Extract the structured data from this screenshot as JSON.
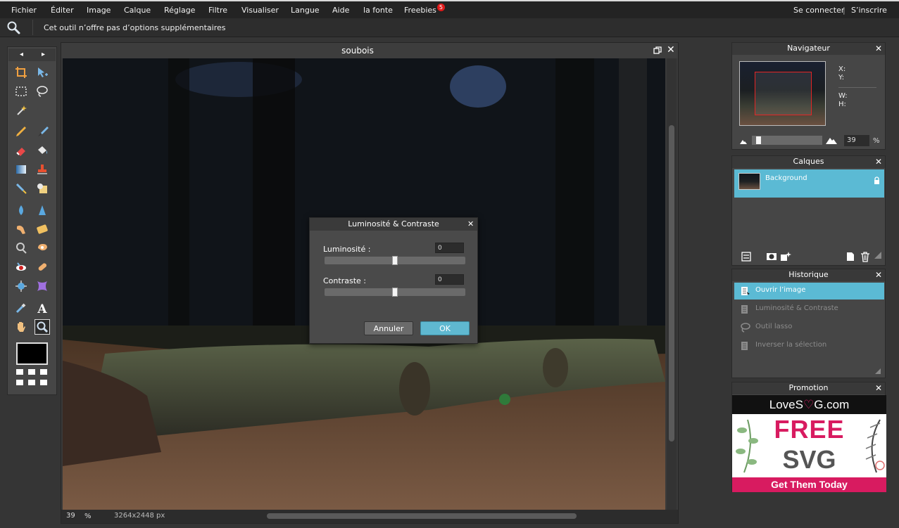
{
  "menu": {
    "items": [
      "Fichier",
      "Éditer",
      "Image",
      "Calque",
      "Réglage",
      "Filtre",
      "Visualiser",
      "Langue",
      "Aide",
      "la fonte",
      "Freebies"
    ],
    "freebies_badge": "5",
    "login": "Se connecter",
    "separator": "|",
    "signup": "S’inscrire"
  },
  "options": {
    "message": "Cet outil n’offre pas d’options supplémentaires",
    "tool_icon": "magnifier-icon"
  },
  "image_window": {
    "title": "soubois",
    "zoom": "39",
    "zoom_unit": "%",
    "dimensions": "3264x2448 px"
  },
  "dialog": {
    "title": "Luminosité & Contraste",
    "brightness_label": "Luminosité :",
    "brightness_value": "0",
    "brightness_level": 0.5,
    "contrast_label": "Contraste :",
    "contrast_value": "0",
    "contrast_level": 0.5,
    "cancel_label": "Annuler",
    "ok_label": "OK"
  },
  "navigator": {
    "title": "Navigateur",
    "x_label": "X:",
    "y_label": "Y:",
    "w_label": "W:",
    "h_label": "H:",
    "zoom_value": "39",
    "zoom_unit": "%"
  },
  "layers": {
    "title": "Calques",
    "items": [
      {
        "name": "Background",
        "locked": true
      }
    ]
  },
  "history": {
    "title": "Historique",
    "items": [
      {
        "label": "Ouvrir l’image",
        "icon": "document-icon",
        "active": true
      },
      {
        "label": "Luminosité & Contraste",
        "icon": "document-icon",
        "active": false
      },
      {
        "label": "Outil lasso",
        "icon": "lasso-icon",
        "active": false
      },
      {
        "label": "Inverser la sélection",
        "icon": "document-icon",
        "active": false
      }
    ]
  },
  "promotion": {
    "title": "Promotion",
    "brand_pre": "LoveS",
    "brand_heart": "♡",
    "brand_post": "G.com",
    "headline1": "FREE",
    "headline2": "SVG",
    "cta": "Get Them Today"
  },
  "colors": {
    "accent": "#5bbad4",
    "promo_pink": "#d81b60",
    "foreground_color": "#000000"
  }
}
